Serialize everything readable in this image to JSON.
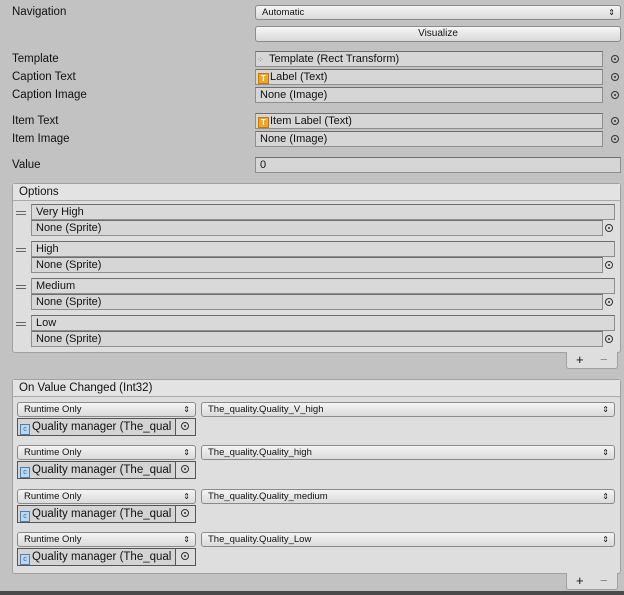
{
  "navigation": {
    "label": "Navigation",
    "value": "Automatic",
    "visualize_label": "Visualize"
  },
  "fields": {
    "template": {
      "label": "Template",
      "value": "Template (Rect Transform)"
    },
    "caption_text": {
      "label": "Caption Text",
      "value": "Label (Text)"
    },
    "caption_image": {
      "label": "Caption Image",
      "value": "None (Image)"
    },
    "item_text": {
      "label": "Item Text",
      "value": "Item Label (Text)"
    },
    "item_image": {
      "label": "Item Image",
      "value": "None (Image)"
    },
    "value": {
      "label": "Value",
      "value": "0"
    }
  },
  "options": {
    "title": "Options",
    "items": [
      {
        "text": "Very High",
        "image": "None (Sprite)"
      },
      {
        "text": "High",
        "image": "None (Sprite)"
      },
      {
        "text": "Medium",
        "image": "None (Sprite)"
      },
      {
        "text": "Low",
        "image": "None (Sprite)"
      }
    ],
    "add": "+",
    "remove": "−"
  },
  "on_value_changed": {
    "title": "On Value Changed (Int32)",
    "listeners": [
      {
        "mode": "Runtime Only",
        "function": "The_quality.Quality_V_high",
        "target": "Quality manager (The_qual"
      },
      {
        "mode": "Runtime Only",
        "function": "The_quality.Quality_high",
        "target": "Quality manager (The_qual"
      },
      {
        "mode": "Runtime Only",
        "function": "The_quality.Quality_medium",
        "target": "Quality manager (The_qual"
      },
      {
        "mode": "Runtime Only",
        "function": "The_quality.Quality_Low",
        "target": "Quality manager (The_qual"
      }
    ],
    "add": "+",
    "remove": "−"
  }
}
